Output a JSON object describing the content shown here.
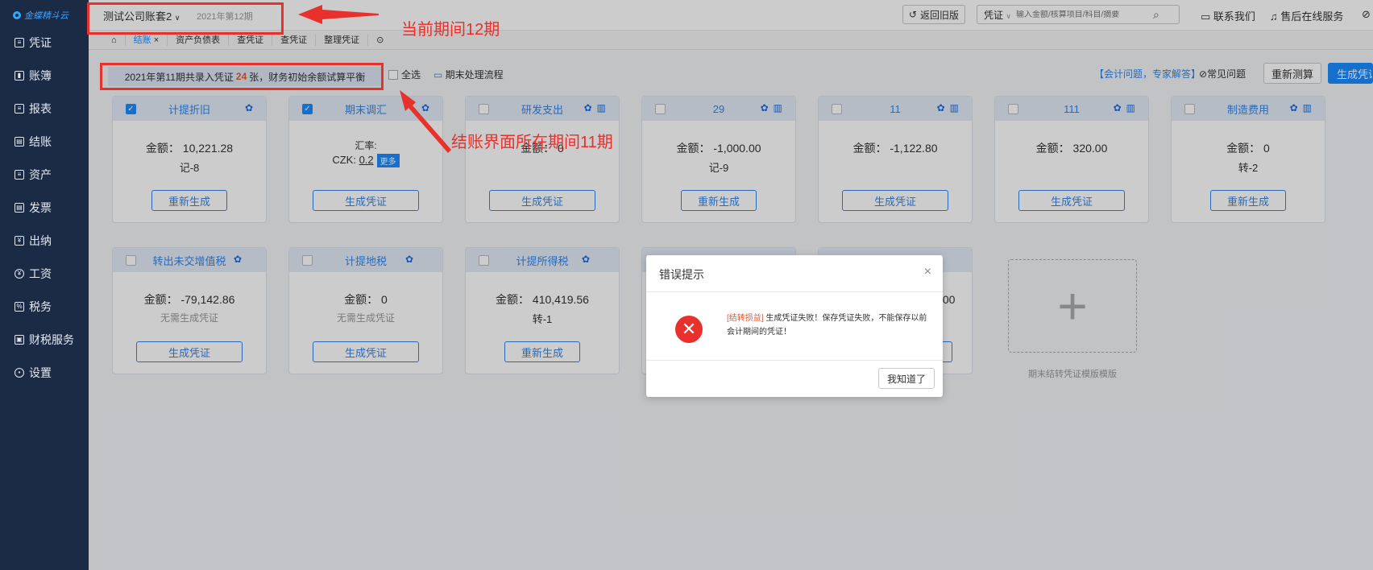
{
  "logo": {
    "text": "金蝶精斗云"
  },
  "sidebar": {
    "items": [
      {
        "label": "凭证"
      },
      {
        "label": "账簿"
      },
      {
        "label": "报表"
      },
      {
        "label": "结账"
      },
      {
        "label": "资产"
      },
      {
        "label": "发票"
      },
      {
        "label": "出纳"
      },
      {
        "label": "工资"
      },
      {
        "label": "税务"
      },
      {
        "label": "财税服务"
      },
      {
        "label": "设置"
      }
    ]
  },
  "header": {
    "account": "测试公司账套2",
    "period": "2021年第12期",
    "back_old": "返回旧版",
    "search_type": "凭证",
    "search_placeholder": "输入金额/核算项目/科目/摘要",
    "contact": "联系我们",
    "service": "售后在线服务"
  },
  "tabs": [
    {
      "label": "结账"
    },
    {
      "label": "资产负债表"
    },
    {
      "label": "查凭证"
    },
    {
      "label": "查凭证"
    },
    {
      "label": "整理凭证"
    }
  ],
  "toolbar": {
    "info_prefix": "2021年第11期共录入凭证",
    "info_count": "24",
    "info_suffix": "张，财务初始余额试算平衡",
    "select_all": "全选",
    "process": "期末处理流程",
    "expert": "【会计问题，专家解答】",
    "faq": "常见问题",
    "recalc": "重新测算",
    "generate": "生成凭证"
  },
  "cards_row1": [
    {
      "title": "计提折旧",
      "checked": true,
      "amount": "金额：  10,221.28",
      "sub": "记-8",
      "button": "重新生成"
    },
    {
      "title": "期末调汇",
      "checked": true,
      "amount": "汇率:",
      "czk_label": "CZK:",
      "czk_value": "0.2",
      "more": "更多",
      "button": "生成凭证"
    },
    {
      "title": "研发支出",
      "checked": false,
      "amount": "金额：  0",
      "button": "生成凭证"
    },
    {
      "title": "29",
      "checked": false,
      "amount": "金额：  -1,000.00",
      "sub": "记-9",
      "button": "重新生成"
    },
    {
      "title": "11",
      "checked": false,
      "amount": "金额：  -1,122.80",
      "button": "生成凭证"
    },
    {
      "title": "111",
      "checked": false,
      "amount": "金额：  320.00",
      "button": "生成凭证"
    },
    {
      "title": "制造费用",
      "checked": false,
      "amount": "金额：  0",
      "sub": "转-2",
      "button": "重新生成"
    }
  ],
  "cards_row2": [
    {
      "title": "转出未交增值税",
      "amount": "金额：  -79,142.86",
      "sub": "无需生成凭证",
      "button": "生成凭证"
    },
    {
      "title": "计提地税",
      "amount": "金额：  0",
      "sub": "无需生成凭证",
      "button": "生成凭证"
    },
    {
      "title": "计提所得税",
      "amount": "金额：  410,419.56",
      "sub": "转-1",
      "button": "重新生成"
    },
    {
      "amount_tail": ".00"
    }
  ],
  "add_template_label": "期末结转凭证模版模版",
  "dialog": {
    "title": "错误提示",
    "tag": "[结转损益]",
    "message": " 生成凭证失败！保存凭证失败，不能保存以前会计期间的凭证！",
    "ok": "我知道了"
  },
  "annotations": {
    "current_period": "当前期间12期",
    "closing_period": "结账界面所在期间11期"
  }
}
